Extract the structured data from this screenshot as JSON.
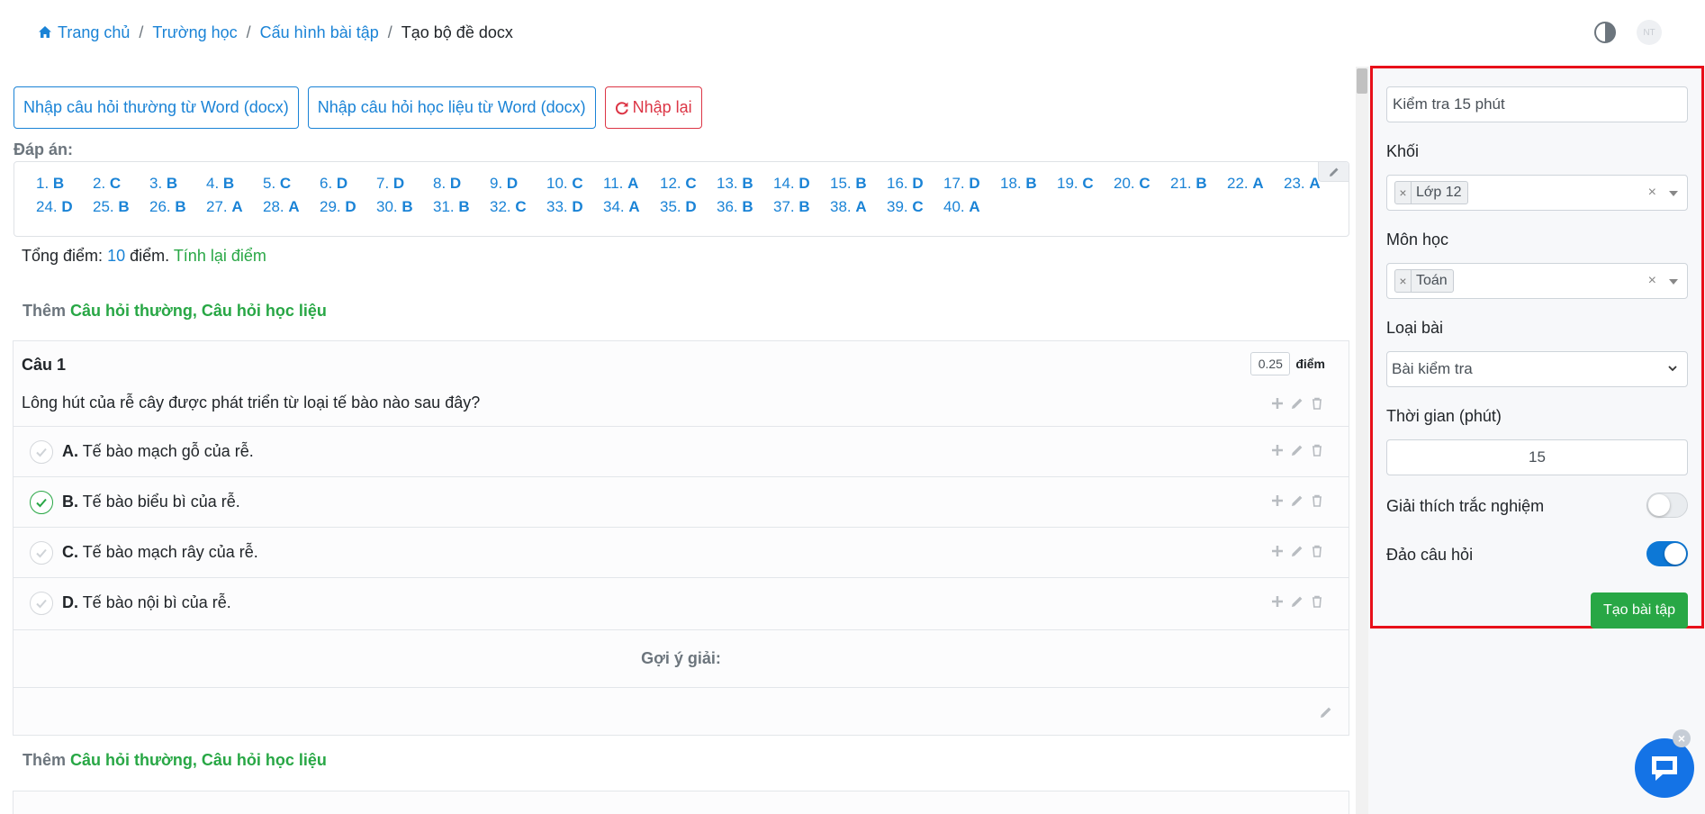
{
  "breadcrumb": {
    "home": "Trang chủ",
    "school": "Trường học",
    "config": "Cấu hình bài tập",
    "current": "Tạo bộ đề docx"
  },
  "header": {
    "avatar_initials": "NT"
  },
  "toolbar": {
    "import_normal": "Nhập câu hỏi thường từ Word (docx)",
    "import_material": "Nhập câu hỏi học liệu từ Word (docx)",
    "reset": "Nhập lại"
  },
  "answers": {
    "label": "Đáp án:",
    "items": [
      {
        "n": "1.",
        "v": "B"
      },
      {
        "n": "2.",
        "v": "C"
      },
      {
        "n": "3.",
        "v": "B"
      },
      {
        "n": "4.",
        "v": "B"
      },
      {
        "n": "5.",
        "v": "C"
      },
      {
        "n": "6.",
        "v": "D"
      },
      {
        "n": "7.",
        "v": "D"
      },
      {
        "n": "8.",
        "v": "D"
      },
      {
        "n": "9.",
        "v": "D"
      },
      {
        "n": "10.",
        "v": "C"
      },
      {
        "n": "11.",
        "v": "A"
      },
      {
        "n": "12.",
        "v": "C"
      },
      {
        "n": "13.",
        "v": "B"
      },
      {
        "n": "14.",
        "v": "D"
      },
      {
        "n": "15.",
        "v": "B"
      },
      {
        "n": "16.",
        "v": "D"
      },
      {
        "n": "17.",
        "v": "D"
      },
      {
        "n": "18.",
        "v": "B"
      },
      {
        "n": "19.",
        "v": "C"
      },
      {
        "n": "20.",
        "v": "C"
      },
      {
        "n": "21.",
        "v": "B"
      },
      {
        "n": "22.",
        "v": "A"
      },
      {
        "n": "23.",
        "v": "A"
      },
      {
        "n": "24.",
        "v": "D"
      },
      {
        "n": "25.",
        "v": "B"
      },
      {
        "n": "26.",
        "v": "B"
      },
      {
        "n": "27.",
        "v": "A"
      },
      {
        "n": "28.",
        "v": "A"
      },
      {
        "n": "29.",
        "v": "D"
      },
      {
        "n": "30.",
        "v": "B"
      },
      {
        "n": "31.",
        "v": "B"
      },
      {
        "n": "32.",
        "v": "C"
      },
      {
        "n": "33.",
        "v": "D"
      },
      {
        "n": "34.",
        "v": "A"
      },
      {
        "n": "35.",
        "v": "D"
      },
      {
        "n": "36.",
        "v": "B"
      },
      {
        "n": "37.",
        "v": "B"
      },
      {
        "n": "38.",
        "v": "A"
      },
      {
        "n": "39.",
        "v": "C"
      },
      {
        "n": "40.",
        "v": "A"
      }
    ]
  },
  "total": {
    "prefix": "Tổng điểm:",
    "value": "10",
    "unit": "điểm.",
    "recalc": "Tính lại điểm"
  },
  "add_links": {
    "prefix": "Thêm",
    "links": "Câu hỏi thường, Câu hỏi học liệu"
  },
  "question": {
    "title": "Câu 1",
    "points": "0.25",
    "points_unit": "điểm",
    "text": "Lông hút của rễ cây được phát triển từ loại tế bào nào sau đây?",
    "options": [
      {
        "letter": "A.",
        "text": "Tế bào mạch gỗ của rễ.",
        "correct": false
      },
      {
        "letter": "B.",
        "text": "Tế bào biểu bì của rễ.",
        "correct": true
      },
      {
        "letter": "C.",
        "text": "Tế bào mạch rây của rễ.",
        "correct": false
      },
      {
        "letter": "D.",
        "text": "Tế bào nội bì của rễ.",
        "correct": false
      }
    ],
    "hint_label": "Gợi ý giải:"
  },
  "settings": {
    "title_value": "Kiểm tra 15 phút",
    "grade_label": "Khối",
    "grade_value": "Lớp 12",
    "subject_label": "Môn học",
    "subject_value": "Toán",
    "type_label": "Loại bài",
    "type_value": "Bài kiểm tra",
    "time_label": "Thời gian (phút)",
    "time_value": "15",
    "explain_label": "Giải thích trắc nghiệm",
    "explain_on": false,
    "shuffle_label": "Đảo câu hỏi",
    "shuffle_on": true,
    "submit": "Tạo bài tập"
  },
  "colors": {
    "primary": "#1a83d6",
    "success": "#28a745",
    "danger": "#dc3545",
    "highlight_frame": "#e8101a"
  }
}
